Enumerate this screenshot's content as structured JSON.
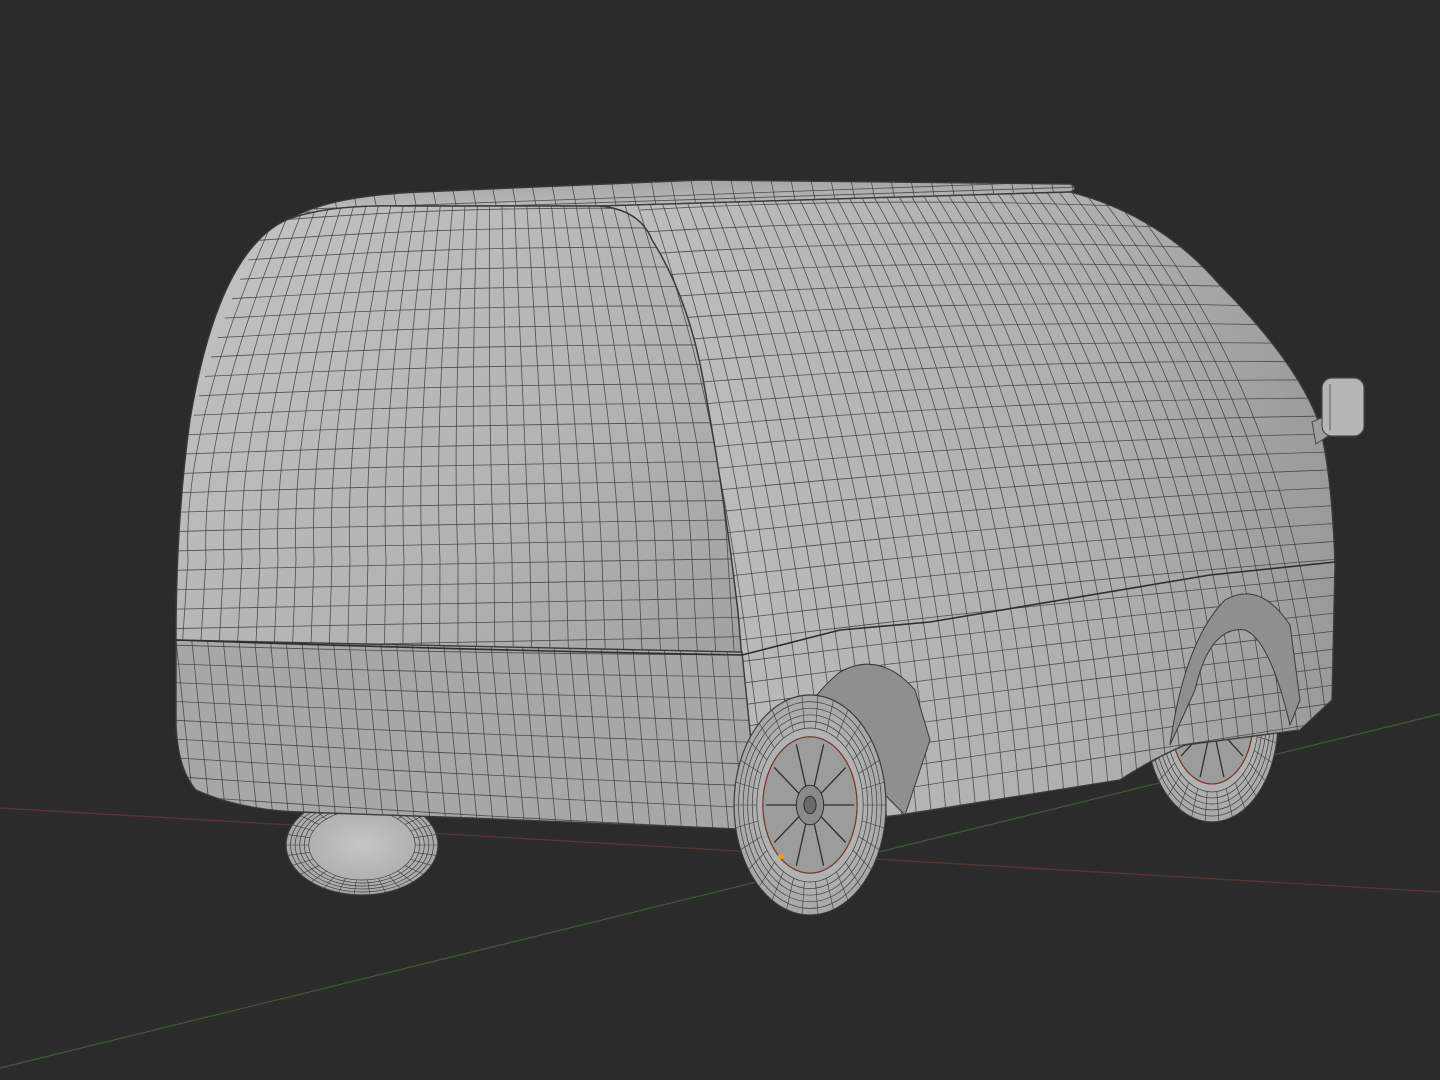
{
  "viewport": {
    "background_color": "#2b2b2b",
    "shading": "solid",
    "overlay": "wireframe",
    "model": "van"
  },
  "colors": {
    "mesh_light": "#bdbdbd",
    "mesh_mid": "#a9a9a9",
    "mesh_dark": "#8e8e8e",
    "mesh_shadow": "#6e6e6e",
    "wire": "#3c3c3c",
    "tire": "#b9b9b9",
    "rim": "#9c9c9c",
    "x_axis": "#5a3838",
    "y_axis": "#3f5a3a",
    "seam": "#7a3a34",
    "origin_dot": "#e0a020"
  }
}
